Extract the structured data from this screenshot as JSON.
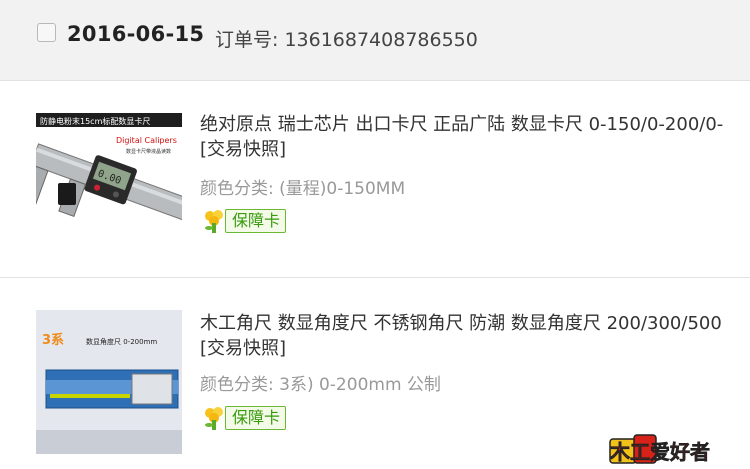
{
  "order": {
    "date": "2016-06-15",
    "label": "订单号: 1361687408786550"
  },
  "items": [
    {
      "title": "绝对原点 瑞士芯片 出口卡尺 正品广陆 数显卡尺 0-150/0-200/0- [交易快照]",
      "spec": "颜色分类: (量程)0-150MM",
      "badge": "保障卡",
      "thumb": {
        "banner": "防静电粉末15cm标配数显卡尺",
        "product": "Digital Calipers",
        "sub": "数显卡尺带液晶读数",
        "display": "0.00"
      }
    },
    {
      "title": "木工角尺 数显角度尺 不锈钢角尺 防潮 数显角度尺 200/300/500 [交易快照]",
      "spec": "颜色分类: 3系) 0-200mm 公制",
      "badge": "保障卡",
      "thumb": {
        "brand": "3系",
        "product": "数显角度尺 0-200mm"
      }
    }
  ],
  "watermark": {
    "text": "木工爱好者",
    "colors": {
      "red": "#d62218",
      "yellow": "#f3c21a"
    }
  },
  "colors": {
    "header_bg": "#f2f2f2",
    "badge_green": "#3a9a0e",
    "spec_gray": "#999999"
  }
}
